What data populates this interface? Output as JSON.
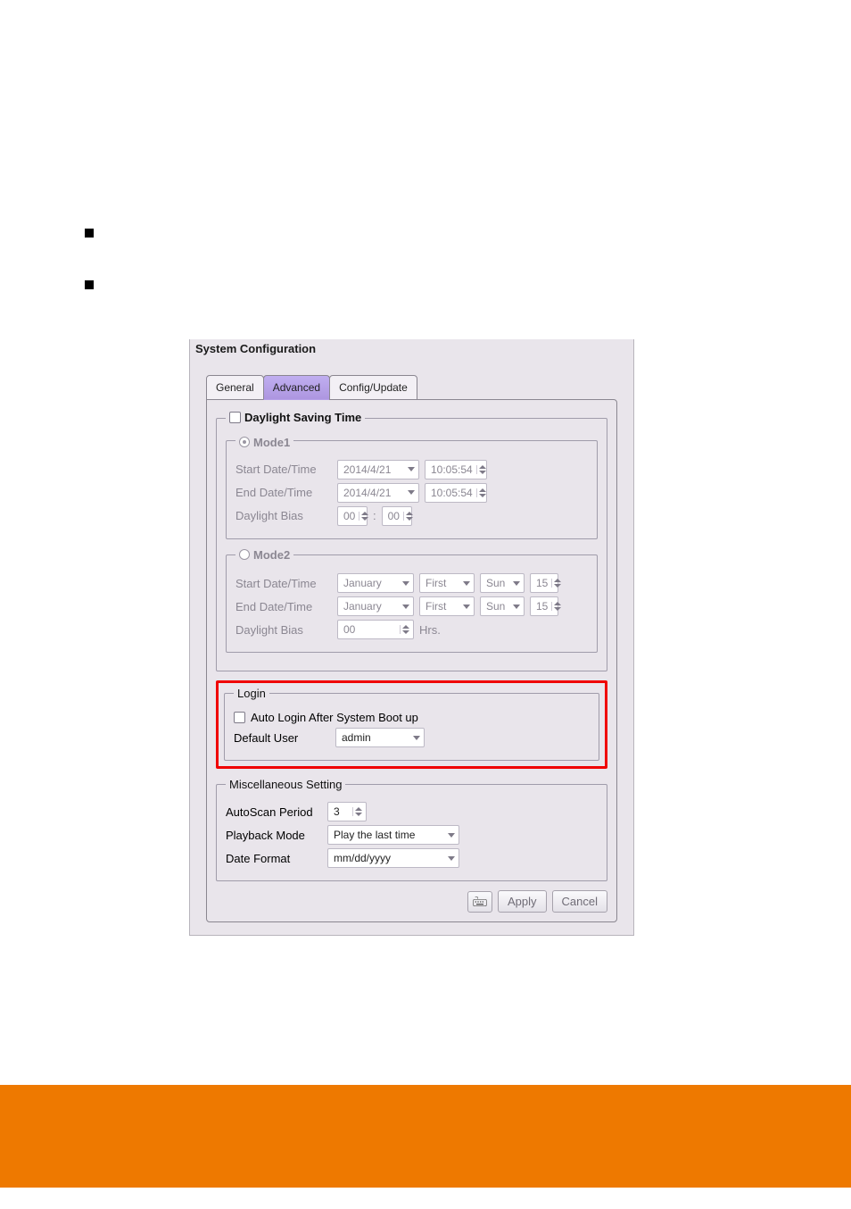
{
  "dialog_title": "System Configuration",
  "tabs": {
    "general": "General",
    "advanced": "Advanced",
    "config": "Config/Update"
  },
  "dst": {
    "legend": "Daylight Saving Time",
    "mode1": {
      "legend": "Mode1",
      "start_label": "Start Date/Time",
      "start_date": "2014/4/21",
      "start_time": "10:05:54",
      "end_label": "End Date/Time",
      "end_date": "2014/4/21",
      "end_time": "10:05:54",
      "bias_label": "Daylight Bias",
      "bias_h": "00",
      "bias_sep": ":",
      "bias_m": "00"
    },
    "mode2": {
      "legend": "Mode2",
      "start_label": "Start Date/Time",
      "start_mon": "January",
      "start_ord": "First",
      "start_day": "Sun",
      "start_hr": "15",
      "end_label": "End Date/Time",
      "end_mon": "January",
      "end_ord": "First",
      "end_day": "Sun",
      "end_hr": "15",
      "bias_label": "Daylight Bias",
      "bias_h": "00",
      "bias_unit": "Hrs."
    }
  },
  "login": {
    "legend": "Login",
    "auto_label": "Auto Login After System Boot up",
    "default_user_label": "Default User",
    "default_user": "admin"
  },
  "misc": {
    "legend": "Miscellaneous Setting",
    "autoscan_label": "AutoScan Period",
    "autoscan_value": "3",
    "playback_label": "Playback Mode",
    "playback_value": "Play the last time",
    "datefmt_label": "Date Format",
    "datefmt_value": "mm/dd/yyyy"
  },
  "buttons": {
    "apply": "Apply",
    "cancel": "Cancel"
  }
}
